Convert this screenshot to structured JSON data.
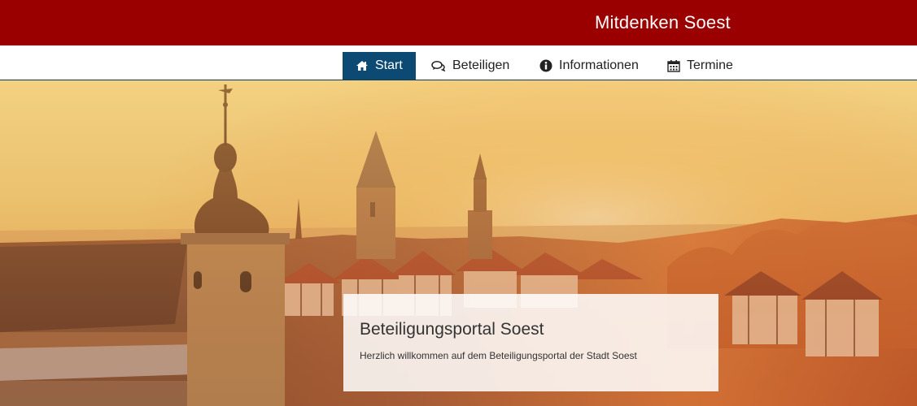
{
  "header": {
    "title": "Mitdenken Soest"
  },
  "nav": {
    "items": [
      {
        "label": "Start",
        "icon": "home-icon",
        "active": true
      },
      {
        "label": "Beteiligen",
        "icon": "comments-icon",
        "active": false
      },
      {
        "label": "Informationen",
        "icon": "info-icon",
        "active": false
      },
      {
        "label": "Termine",
        "icon": "calendar-icon",
        "active": false
      }
    ]
  },
  "hero": {
    "image": "sunset-city-skyline-photo",
    "card": {
      "title": "Beteiligungsportal Soest",
      "text": "Herzlich willkommen auf dem Beteiligungsportal der Stadt Soest"
    }
  },
  "colors": {
    "header_bg": "#9b0000",
    "nav_active_bg": "#0d4a73",
    "nav_border": "#0d3b5e"
  }
}
